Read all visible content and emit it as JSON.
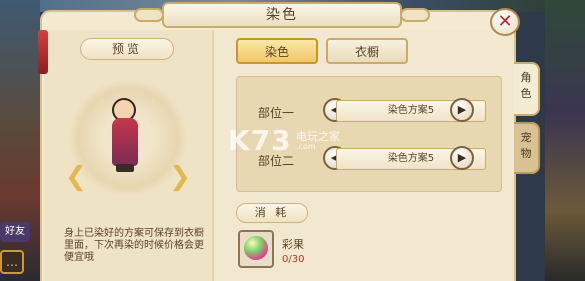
{
  "window": {
    "title": "染色",
    "close_icon": "close-x-icon"
  },
  "left_pane": {
    "preview_label": "预览",
    "hint": "身上已染好的方案可保存到衣橱里面，下次再染的时候价格会更便宜哦",
    "rotate_left_icon": "rotate-left-arrow-icon",
    "rotate_right_icon": "rotate-right-arrow-icon"
  },
  "tabs": [
    {
      "label": "染色",
      "active": true
    },
    {
      "label": "衣橱",
      "active": false
    }
  ],
  "parts": [
    {
      "label": "部位一",
      "scheme": "染色方案5"
    },
    {
      "label": "部位二",
      "scheme": "染色方案5"
    }
  ],
  "consume": {
    "label": "消 耗",
    "item_name": "彩果",
    "item_count": "0/30"
  },
  "side_tabs": [
    {
      "label": "角色",
      "active": true
    },
    {
      "label": "宠物",
      "active": false
    }
  ],
  "watermark": {
    "logo": "K73",
    "sub": "电玩之家",
    "url": ".com"
  },
  "game_ui": {
    "friend": "好友",
    "chat_icon": "chat-bubble-icon"
  },
  "colors": {
    "accent": "#f0c86a",
    "panel": "#f4ead1",
    "close": "#c0262a",
    "count": "#b8332a"
  }
}
